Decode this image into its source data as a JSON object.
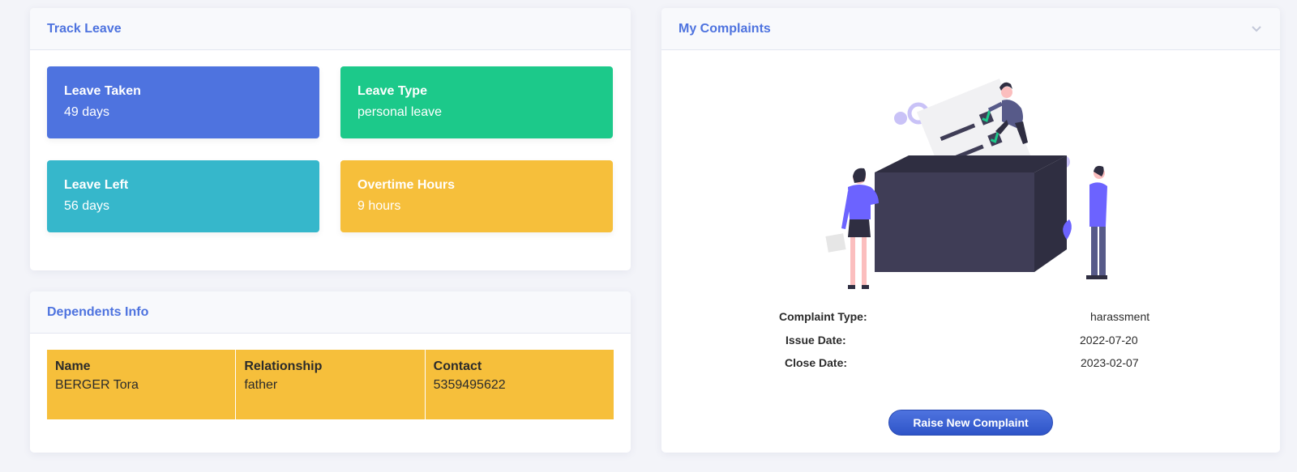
{
  "track_leave": {
    "title": "Track Leave",
    "tiles": [
      {
        "label": "Leave Taken",
        "value": "49 days",
        "color": "#4e73df"
      },
      {
        "label": "Leave Type",
        "value": "personal leave",
        "color": "#1cc98a"
      },
      {
        "label": "Leave Left",
        "value": "56 days",
        "color": "#36b7cb"
      },
      {
        "label": "Overtime Hours",
        "value": "9 hours",
        "color": "#f6bf3b"
      }
    ]
  },
  "dependents": {
    "title": "Dependents Info",
    "columns": [
      {
        "header": "Name",
        "value": "BERGER Tora"
      },
      {
        "header": "Relationship",
        "value": "father"
      },
      {
        "header": "Contact",
        "value": "5359495622"
      }
    ],
    "table_color": "#f6bf3b"
  },
  "complaints": {
    "title": "My Complaints",
    "collapse_icon": "chevron-down-icon",
    "illustration": "ballot-box-illustration",
    "type_label": "Complaint Type:",
    "type_value": "harassment",
    "issue_label": "Issue Date:",
    "issue_value": "2022-07-20",
    "close_label": "Close Date:",
    "close_value": "2023-02-07",
    "button_label": "Raise New Complaint"
  },
  "colors": {
    "accent": "#4e73df",
    "header_bg": "#f8f9fc",
    "page_bg": "#f3f4f9"
  }
}
